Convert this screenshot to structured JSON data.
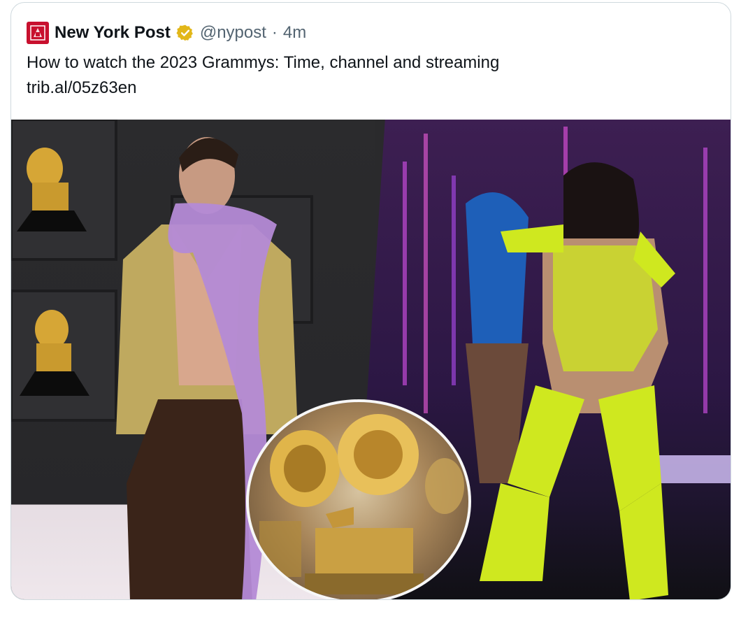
{
  "tweet": {
    "display_name": "New York Post",
    "handle": "@nypost",
    "separator": "·",
    "timestamp": "4m",
    "text": "How to watch the 2023 Grammys: Time, channel and streaming",
    "link": "trib.al/05z63en"
  },
  "media": {
    "left_photo": "harry-styles-grammy-backdrop",
    "right_photo": "lizzo-performing-stage",
    "inset_photo": "grammy-trophies"
  },
  "icons": {
    "logo": "nypost-logo-icon",
    "verified": "verified-badge-icon"
  },
  "colors": {
    "brand_red": "#c8102e",
    "verified_gold": "#e2b719",
    "handle_gray": "#536471",
    "border": "#cfd9de"
  }
}
